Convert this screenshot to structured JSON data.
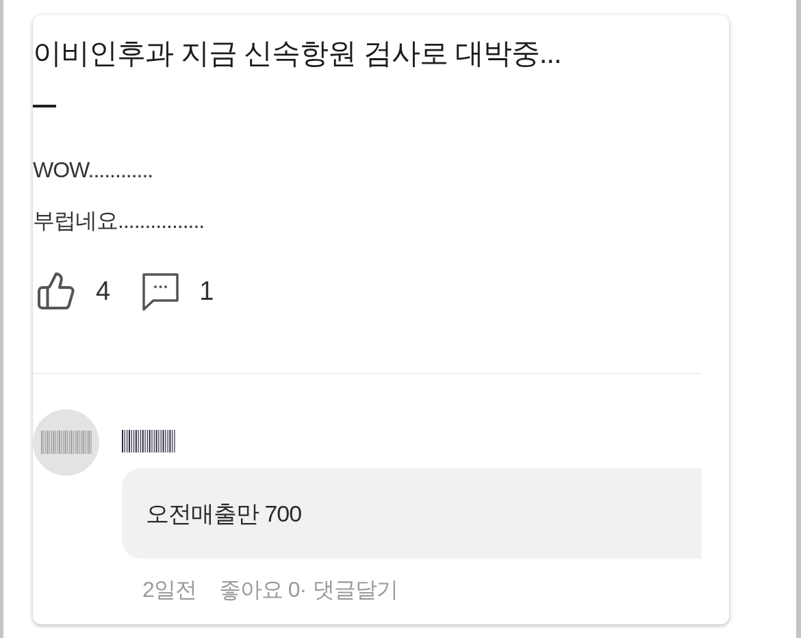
{
  "post": {
    "title": "이비인후과 지금 신속항원 검사로 대박중...",
    "body": [
      "WOW............",
      "부럽네요................"
    ],
    "likes": "4",
    "comments": "1"
  },
  "comment": {
    "text": "오전매출만 700",
    "time": "2일전",
    "like_label": "좋아요 0·",
    "reply_label": "댓글달기"
  }
}
